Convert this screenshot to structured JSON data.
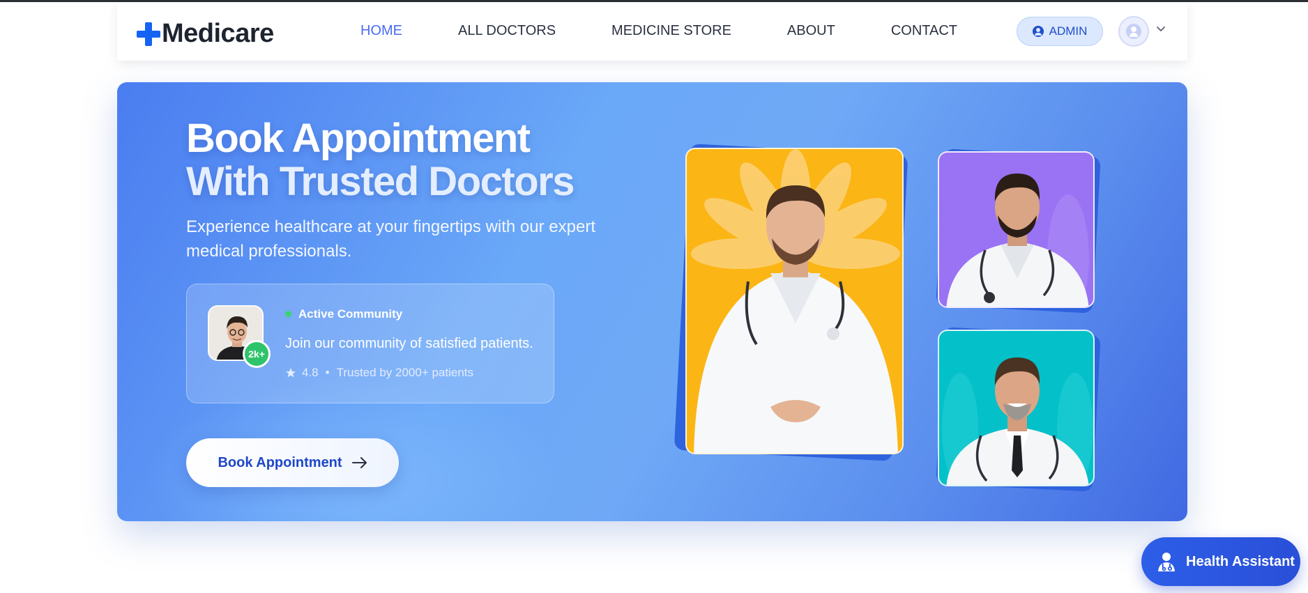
{
  "brand": {
    "name": "Medicare",
    "accent": "#1463f3"
  },
  "nav": {
    "links": [
      {
        "label": "HOME",
        "active": true
      },
      {
        "label": "ALL DOCTORS"
      },
      {
        "label": "MEDICINE STORE"
      },
      {
        "label": "ABOUT"
      },
      {
        "label": "CONTACT"
      }
    ],
    "admin_label": "ADMIN",
    "admin_icon": "user-circle-icon",
    "avatar_icon": "user-avatar-icon",
    "dropdown_icon": "chevron-down-icon"
  },
  "hero": {
    "title_line1": "Book Appointment",
    "title_line2": "With Trusted Doctors",
    "subtitle": "Experience healthcare at your fingertips with our expert medical professionals.",
    "community": {
      "badge": "2k+",
      "label": "Active Community",
      "text": "Join our community of satisfied patients.",
      "rating": "4.8",
      "separator": "•",
      "trusted": "Trusted by 2000+ patients"
    },
    "cta_label": "Book Appointment",
    "cta_icon": "arrow-right-icon",
    "colors": {
      "card1": "#fbb514",
      "card2": "#9a72f4",
      "card3": "#04c0c8"
    }
  },
  "assistant": {
    "label": "Health Assistant",
    "icon": "doctor-icon"
  }
}
